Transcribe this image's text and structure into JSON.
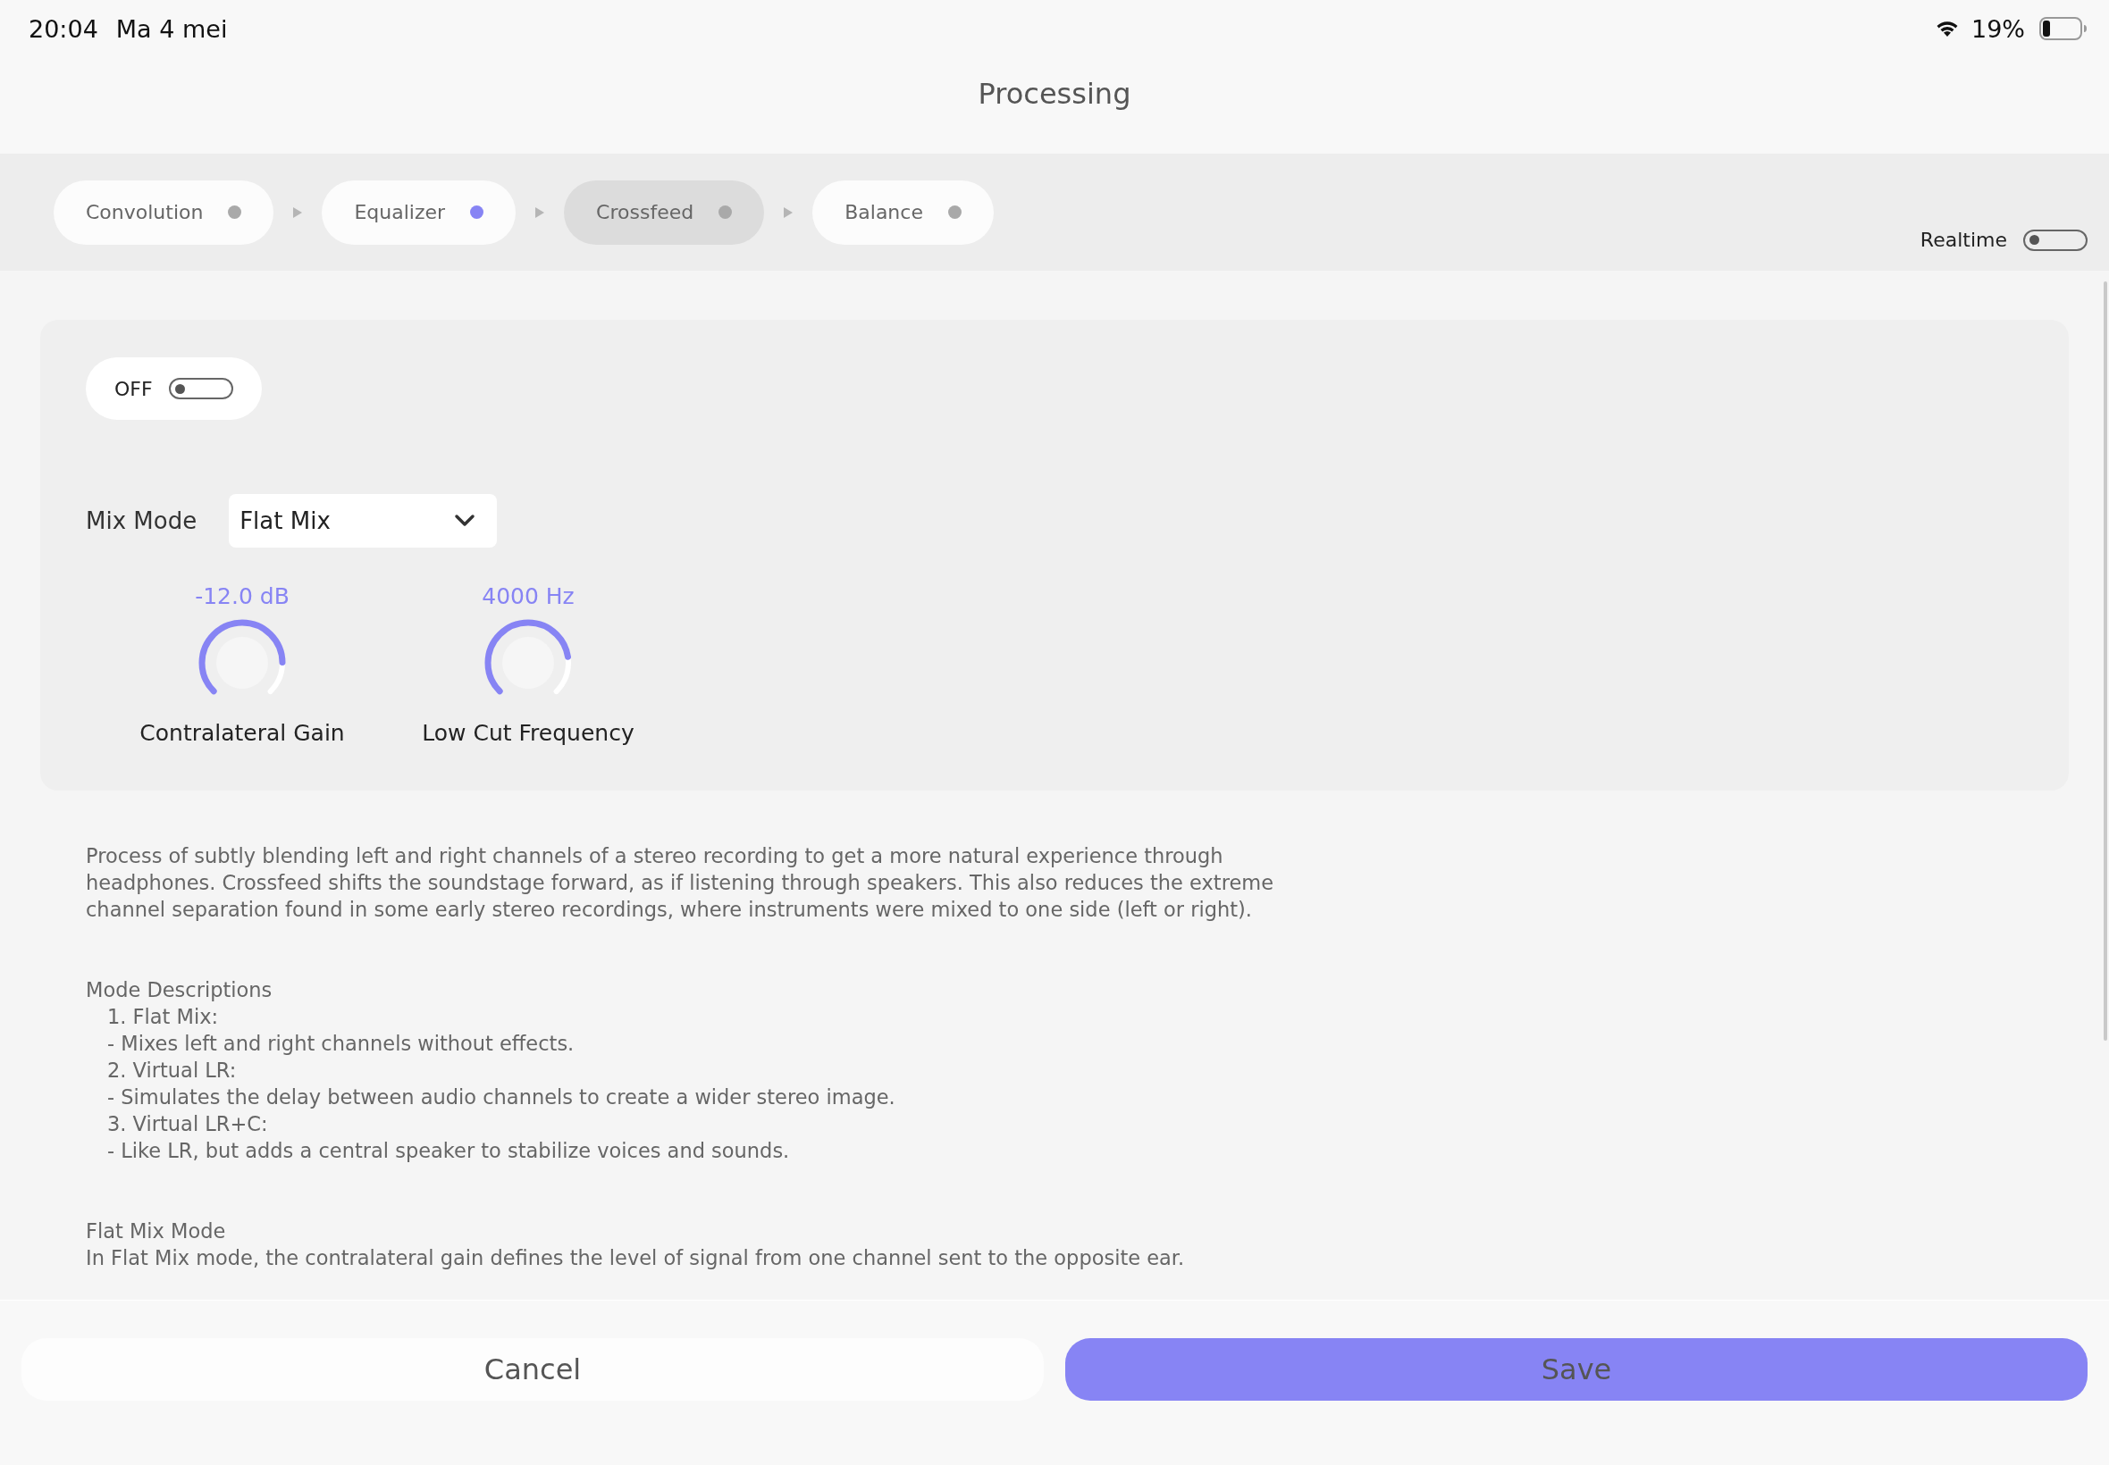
{
  "status_bar": {
    "time": "20:04",
    "date": "Ma 4 mei",
    "battery": "19%"
  },
  "title": "Processing",
  "tabs": [
    {
      "label": "Convolution",
      "selected": false,
      "on": false
    },
    {
      "label": "Equalizer",
      "selected": false,
      "on": true
    },
    {
      "label": "Crossfeed",
      "selected": true,
      "on": false
    },
    {
      "label": "Balance",
      "selected": false,
      "on": false
    }
  ],
  "realtime": {
    "label": "Realtime",
    "on": false
  },
  "panel": {
    "power": {
      "label": "OFF",
      "on": false
    },
    "mix_mode": {
      "label": "Mix Mode",
      "value": "Flat Mix"
    },
    "knobs": [
      {
        "reading": "-12.0 dB",
        "label": "Contralateral Gain",
        "level": 0.83
      },
      {
        "reading": "4000 Hz",
        "label": "Low Cut Frequency",
        "level": 0.8
      }
    ]
  },
  "description": [
    {
      "kind": "paragraph",
      "text": "Process of subtly blending left and right channels of a stereo recording to get a more natural experience through headphones. Crossfeed shifts the soundstage forward, as if listening through speakers. This also reduces the extreme channel separation found in some early stereo recordings, where instruments were mixed to one side (left or right)."
    },
    {
      "kind": "gap"
    },
    {
      "kind": "heading",
      "text": "Mode Descriptions"
    },
    {
      "kind": "item",
      "text": "1. Flat Mix:"
    },
    {
      "kind": "item",
      "text": "- Mixes left and right channels without effects."
    },
    {
      "kind": "item",
      "text": "2. Virtual LR:"
    },
    {
      "kind": "item",
      "text": "- Simulates the delay between audio channels to create a wider stereo image."
    },
    {
      "kind": "item",
      "text": "3. Virtual LR+C:"
    },
    {
      "kind": "item",
      "text": "- Like LR, but adds a central speaker to stabilize voices and sounds."
    },
    {
      "kind": "gap"
    },
    {
      "kind": "heading",
      "text": "Flat Mix Mode"
    },
    {
      "kind": "heading",
      "text": "In Flat Mix mode, the contralateral gain defines the level of signal from one channel sent to the opposite ear."
    }
  ],
  "buttons": [
    {
      "label": "Cancel",
      "kind": "secondary"
    },
    {
      "label": "Save",
      "kind": "primary"
    }
  ]
}
